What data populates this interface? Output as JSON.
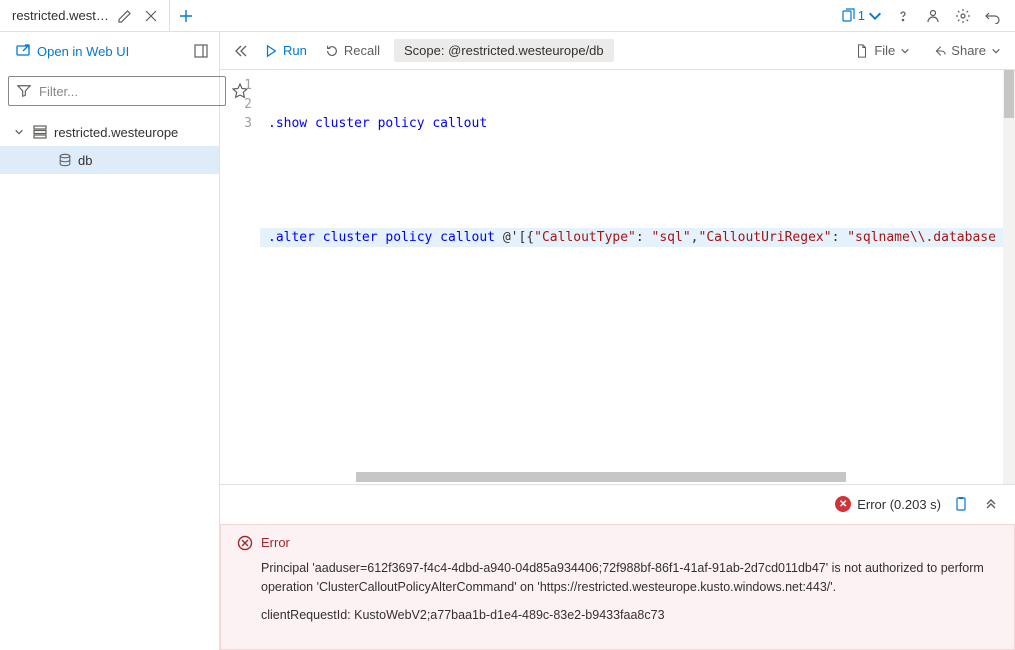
{
  "tab": {
    "title": "restricted.westeur..."
  },
  "tabbar_right": {
    "count": "1"
  },
  "sidebar": {
    "open_web": "Open in Web UI",
    "filter_placeholder": "Filter...",
    "cluster": "restricted.westeurope",
    "db": "db"
  },
  "toolbar": {
    "run": "Run",
    "recall": "Recall",
    "scope_label": "Scope:",
    "scope_value": "@restricted.westeurope/db",
    "file": "File",
    "share": "Share"
  },
  "editor": {
    "lines": [
      "1",
      "2",
      "3"
    ],
    "line1_kw": ".show cluster policy callout",
    "line3_kw": ".alter cluster policy callout ",
    "line3_op": "@'[{",
    "line3_k1": "\"CalloutType\"",
    "line3_c1": ": ",
    "line3_v1": "\"sql\"",
    "line3_cma": ",",
    "line3_k2": "\"CalloutUriRegex\"",
    "line3_c2": ": ",
    "line3_v2": "\"sqlname\\\\.database"
  },
  "results": {
    "status": "Error (0.203 s)",
    "error_label": "Error",
    "error_msg": "Principal 'aaduser=612f3697-f4c4-4dbd-a940-04d85a934406;72f988bf-86f1-41af-91ab-2d7cd011db47' is not authorized to perform operation 'ClusterCalloutPolicyAlterCommand' on 'https://restricted.westeurope.kusto.windows.net:443/'.",
    "client_req": "clientRequestId: KustoWebV2;a77baa1b-d1e4-489c-83e2-b9433faa8c73"
  }
}
